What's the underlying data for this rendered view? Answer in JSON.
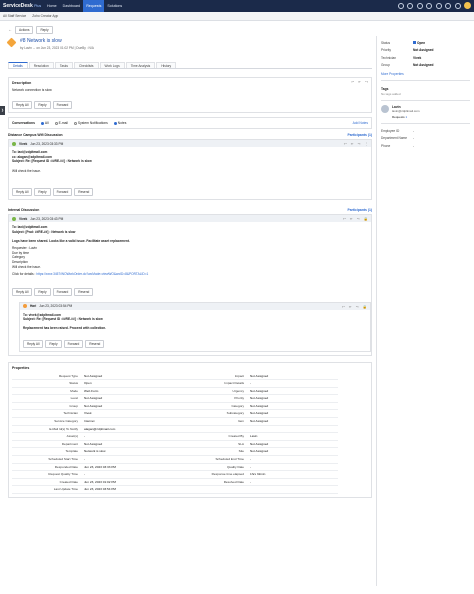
{
  "topnav": {
    "brand": "ServiceDesk",
    "brand_plus": "Plus",
    "tabs": [
      "Home",
      "Dashboard",
      "Requests",
      "Solutions"
    ],
    "active_tab": "Requests"
  },
  "subbar": {
    "items": [
      "All Staff Service",
      "Zoho Creator App"
    ]
  },
  "actionbar": {
    "actions_label": "Actions",
    "reply_label": "Reply",
    "back": "←"
  },
  "request": {
    "id_title": "#8 Network is slow",
    "meta": "by Lavin  ⌄  on Jun 23, 2023 01:02 PM  |  DueBy : N/A",
    "tabs": [
      "Details",
      "Resolution",
      "Tasks",
      "Checklists",
      "Work Logs",
      "Time Analysis",
      "History"
    ],
    "active_tab": "Details"
  },
  "description": {
    "title": "Description",
    "text": "Network connection is slow",
    "buttons": [
      "Reply All",
      "Reply",
      "Forward"
    ]
  },
  "conversations": {
    "label": "Conversations",
    "options": [
      "All",
      "E-mail",
      "System Notifications",
      "Notes"
    ],
    "add_notes": "Add Notes"
  },
  "external": {
    "label": "Distance Campus Wifi Discussion",
    "participants": "Participants (1)",
    "sender": "Vivek",
    "time": "Jun 23, 2023 03:33 PM",
    "to": "To: laxi@zdpltmail.com",
    "cc": "cc: alagan@zdpltmail.com",
    "subject": "Subject: Re: [Request ID :##RE-##] : Network is slow",
    "body": "Will check the issue.",
    "buttons": [
      "Reply All",
      "Reply",
      "Forward",
      "Resend"
    ]
  },
  "internal": {
    "label": "Internal Discussion",
    "participants": "Participants (1)",
    "sender": "Vivek",
    "time": "Jun 23, 2023 03:43 PM",
    "to": "To: laxi@zdpltmail.com",
    "subject": "Subject: [Fwd: ##RE-##] : Network is slow",
    "lines": [
      "Logs have been shared. Looks like a valid issue. Facilitate asset replacement.",
      "Requester : Lavin",
      "Due by time",
      "Category",
      "Description",
      "Will check the issue."
    ],
    "click_details": "Click for details :",
    "link": "https://xxxx:3457/WOWorkOrder.do?woMode=viewWO&woID=8&PORTALID=1",
    "buttons": [
      "Reply All",
      "Reply",
      "Forward",
      "Resend"
    ]
  },
  "nested": {
    "sender": "Hari",
    "time": "Jun 23, 2023 03:54 PM",
    "to": "To: vivek@zdpltmail.com",
    "subject": "Subject: Re: [Request ID :##RE-##] : Network is slow",
    "body": "Replacement has been raised. Proceed with collection.",
    "buttons": [
      "Reply All",
      "Reply",
      "Forward",
      "Resend"
    ]
  },
  "properties": {
    "title": "Properties",
    "rows": [
      [
        "Request Type",
        "Not Assigned",
        "Impact",
        "Not Assigned"
      ],
      [
        "Status",
        "Open",
        "Impact Details",
        "-"
      ],
      [
        "Mode",
        "Web Form",
        "Urgency",
        "Not Assigned"
      ],
      [
        "Level",
        "Not Assigned",
        "Priority",
        "Not Assigned"
      ],
      [
        "Group",
        "Not Assigned",
        "Category",
        "Not Assigned"
      ],
      [
        "Technician",
        "Vivek",
        "Subcategory",
        "Not Assigned"
      ],
      [
        "Service Category",
        "Internet",
        "Item",
        "Not Assigned"
      ],
      [
        "E-Mail Id(s) To Notify",
        "alagan@zdpltmail.com",
        "",
        ""
      ],
      [
        "Asset(s)",
        "-",
        "Created By",
        "Lavin"
      ],
      [
        "Department",
        "Not Assigned",
        "SLA",
        "Not Assigned"
      ],
      [
        "Template",
        "Network is slow",
        "Site",
        "Not Assigned"
      ],
      [
        "Scheduled Start Time",
        "-",
        "Scheduled End Time",
        "-"
      ],
      [
        "Responded Date",
        "Jun 23, 2023 03:33 PM",
        "Quality Date",
        "-"
      ],
      [
        "Request Quality Time",
        "-",
        "Response time elapsed",
        "1hrs 32min"
      ],
      [
        "Created Date",
        "Jun 23, 2023 01:02 PM",
        "Resolved Date",
        "-"
      ],
      [
        "Last Update Time",
        "Jun 23, 2023 03:54 PM",
        "",
        ""
      ]
    ]
  },
  "side": {
    "fields": [
      [
        "Status",
        "Open"
      ],
      [
        "Priority",
        "Not Assigned"
      ],
      [
        "Technician",
        "Vivek"
      ],
      [
        "Group",
        "Not Assigned"
      ]
    ],
    "more_props": "More Properties",
    "tags_title": "Tags",
    "tags_empty": "No tags added",
    "requester_name": "Lavin",
    "requester_email": "lavin@zdpltmail.com",
    "requests_label": "Requests",
    "requests_count": "1",
    "req_fields": [
      [
        "Employee ID",
        "-"
      ],
      [
        "Department Name",
        "-"
      ],
      [
        "Phone",
        "-"
      ]
    ]
  },
  "left_tab": "❯"
}
